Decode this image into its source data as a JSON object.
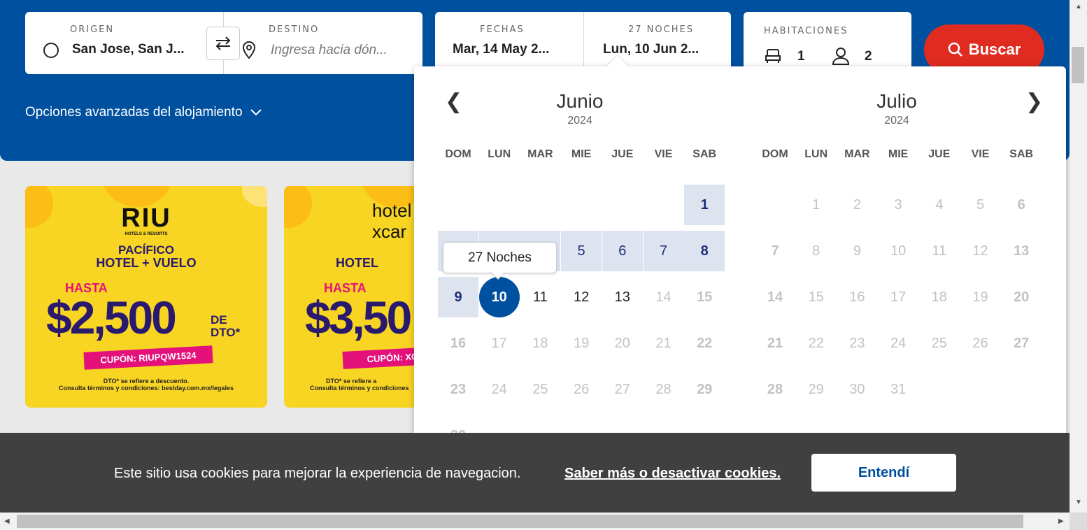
{
  "search": {
    "origin_label": "ORIGEN",
    "origin_value": "San Jose, San J...",
    "destination_label": "DESTINO",
    "destination_placeholder": "Ingresa hacia dón...",
    "dates_label": "FECHAS",
    "dates_value": "Mar, 14 May 2...",
    "nights_label": "27 NOCHES",
    "nights_value": "Lun, 10 Jun 2...",
    "rooms_label": "HABITACIONES",
    "rooms_count": "1",
    "guests_count": "2",
    "search_button": "Buscar",
    "advanced_options": "Opciones avanzadas del alojamiento"
  },
  "promos": [
    {
      "brand": "RIU",
      "brand_sub": "HOTELS & RESORTS",
      "region": "PACÍFICO",
      "package": "HOTEL + VUELO",
      "upto": "HASTA",
      "amount": "$2,500",
      "suffix": "DE DTO*",
      "coupon": "CUPÓN: RIUPQW1524",
      "fine1": "DTO* se refiere a descuento.",
      "fine2": "Consulta términos y condiciones: bestday.com.mx/legales"
    },
    {
      "brand": "hotel xcar",
      "package": "HOTEL",
      "upto": "HASTA",
      "amount": "$3,50",
      "coupon": "CUPÓN: XCT",
      "fine1": "DTO* se refiere a",
      "fine2": "Consulta términos y condiciones"
    }
  ],
  "calendar": {
    "months": [
      {
        "name": "Junio",
        "year": "2024"
      },
      {
        "name": "Julio",
        "year": "2024"
      }
    ],
    "weekdays": [
      "DOM",
      "LUN",
      "MAR",
      "MIE",
      "JUE",
      "VIE",
      "SAB"
    ],
    "tooltip": "27 Noches",
    "selected_day": "10"
  },
  "cookie": {
    "text": "Este sitio usa cookies para mejorar la experiencia de navegacion.",
    "link": "Saber más o desactivar cookies.",
    "button": "Entendí"
  },
  "colors": {
    "brand_blue": "#0050a0",
    "search_red": "#e02b20",
    "range_bg": "#dde4f0",
    "promo_yellow": "#f8d423"
  }
}
